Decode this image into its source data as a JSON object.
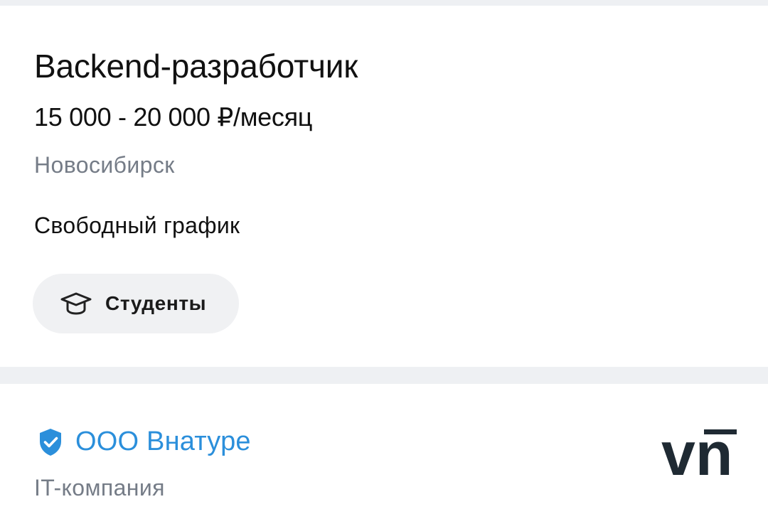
{
  "vacancy": {
    "title": "Backend-разработчик",
    "salary": "15 000 - 20 000 ₽/месяц",
    "city": "Новосибирск",
    "schedule": "Свободный график",
    "tag": {
      "label": "Студенты",
      "icon": "graduation-cap-icon"
    }
  },
  "company": {
    "verified_icon": "verified-shield-icon",
    "name": "ООО Внатуре",
    "type": "IT-компания",
    "logo_text": "vn"
  },
  "colors": {
    "background": "#eef0f3",
    "card": "#ffffff",
    "text_primary": "#111111",
    "text_secondary": "#757c87",
    "company_link": "#2b8fdb",
    "chip_bg": "#f0f1f3",
    "logo": "#1f2a33"
  }
}
